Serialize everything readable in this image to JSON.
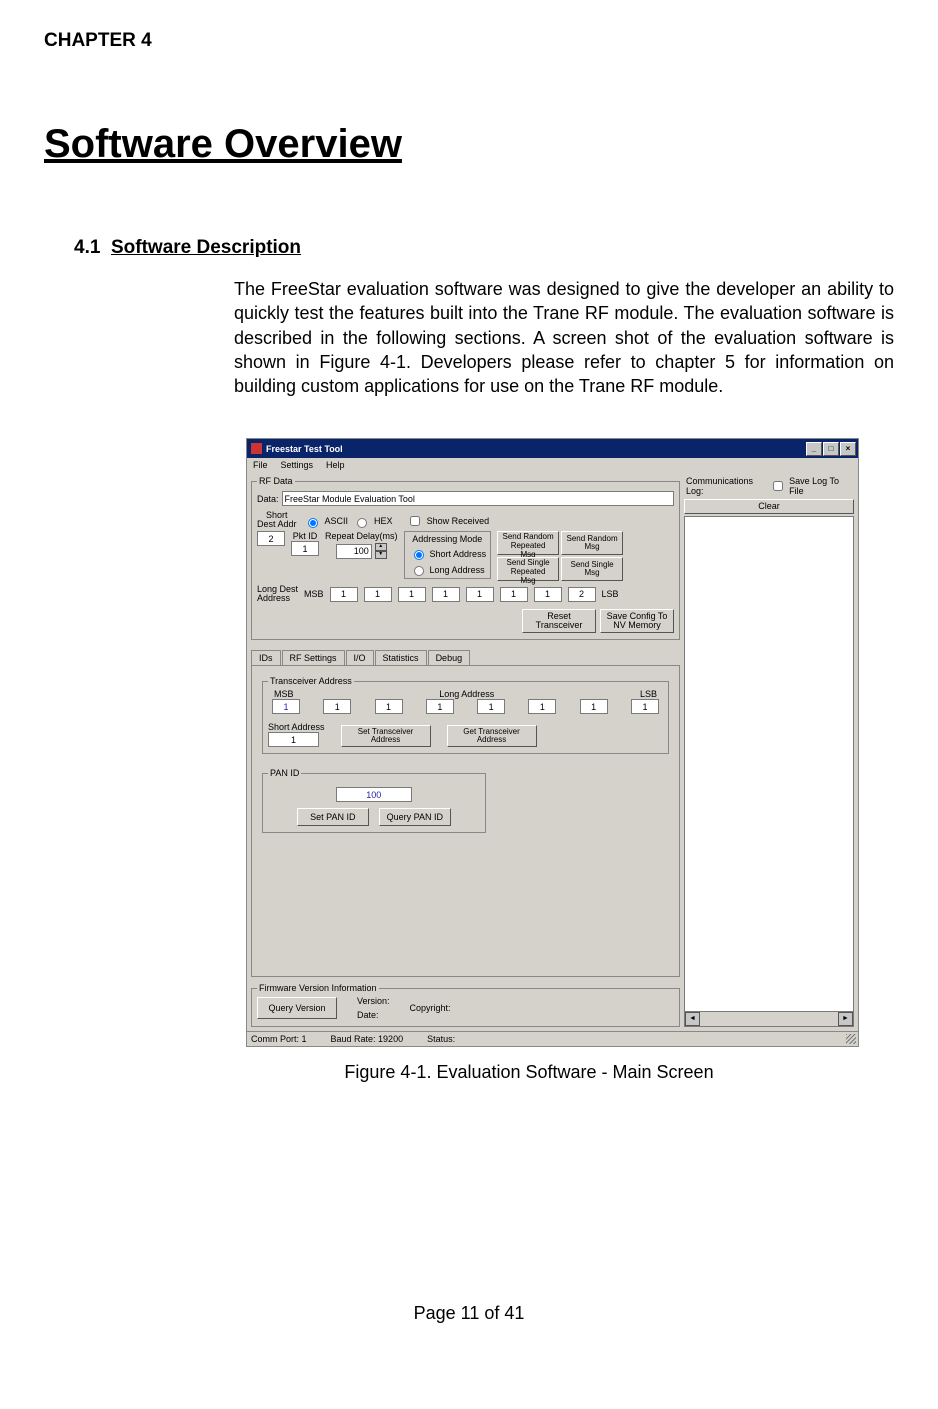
{
  "doc": {
    "chapter_label": "CHAPTER 4",
    "title": "Software Overview",
    "subtitle_num": "4.1",
    "subtitle": "Software Description",
    "body": "The FreeStar evaluation software was designed to give the developer an ability to quickly test the features built into the Trane RF module. The evaluation software is described in the following sections.  A screen shot of the evaluation software is shown in Figure 4-1.  Developers please refer to chapter 5 for information on building custom applications for use on the Trane RF module.",
    "caption": "Figure 4-1. Evaluation Software - Main Screen",
    "pagenum": "Page 11 of 41"
  },
  "window": {
    "title": "Freestar Test Tool",
    "menus": [
      "File",
      "Settings",
      "Help"
    ],
    "rf": {
      "group": "RF Data",
      "data_label": "Data:",
      "data_value": "FreeStar Module Evaluation Tool",
      "ascii": "ASCII",
      "hex": "HEX",
      "show_received": "Show Received",
      "short_dest": "Short\nDest Addr",
      "short_dest_val": "2",
      "pktid": "Pkt ID",
      "pktid_val": "1",
      "repeat": "Repeat Delay(ms)",
      "repeat_val": "100",
      "addr_mode": "Addressing Mode",
      "short_addr_rb": "Short Address",
      "long_addr_rb": "Long Address",
      "btn_rand_rep": "Send Random\nRepeated Msg",
      "btn_rand": "Send Random\nMsg",
      "btn_single_rep": "Send Single\nRepeated Msg",
      "btn_single": "Send Single\nMsg",
      "long_dest": "Long Dest\nAddress",
      "msb": "MSB",
      "lsb": "LSB",
      "ld_vals": [
        "1",
        "1",
        "1",
        "1",
        "1",
        "1",
        "1",
        "2"
      ],
      "reset": "Reset\nTransceiver",
      "savecfg": "Save Config To\nNV Memory"
    },
    "tabs": [
      "IDs",
      "RF Settings",
      "I/O",
      "Statistics",
      "Debug"
    ],
    "ta": {
      "group": "Transceiver Address",
      "msb": "MSB",
      "long": "Long Address",
      "lsb": "LSB",
      "vals": [
        "1",
        "1",
        "1",
        "1",
        "1",
        "1",
        "1",
        "1"
      ],
      "short": "Short Address",
      "short_val": "1",
      "set": "Set Transceiver\nAddress",
      "get": "Get Transceiver\nAddress"
    },
    "pan": {
      "group": "PAN ID",
      "val": "100",
      "set": "Set PAN ID",
      "query": "Query PAN ID"
    },
    "fw": {
      "group": "Firmware Version Information",
      "query": "Query Version",
      "version": "Version:",
      "date": "Date:",
      "copyright": "Copyright:"
    },
    "comm": {
      "title": "Communications Log:",
      "save": "Save Log To File",
      "clear": "Clear"
    },
    "status": {
      "comm": "Comm Port: 1",
      "baud": "Baud Rate: 19200",
      "status": "Status:"
    }
  }
}
